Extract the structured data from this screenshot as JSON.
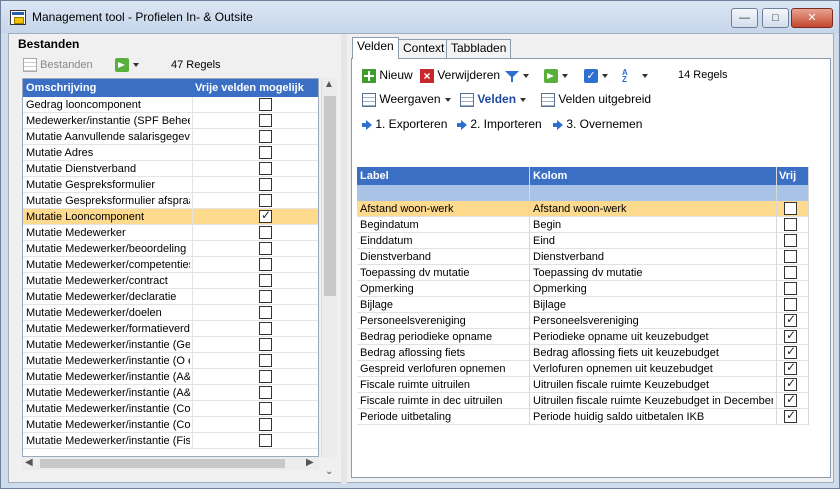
{
  "window": {
    "title": "Management tool - Profielen In- & Outsite"
  },
  "left": {
    "title": "Bestanden",
    "toolbar": {
      "bestanden_label": "Bestanden",
      "count_label": "47 Regels"
    },
    "columns": {
      "name": "Omschrijving",
      "vrij": "Vrije velden mogelijk"
    },
    "rows": [
      {
        "name": "Gedrag looncomponent",
        "checked": false,
        "selected": false
      },
      {
        "name": "Medewerker/instantie (SPF Beheer)",
        "checked": false,
        "selected": false
      },
      {
        "name": "Mutatie Aanvullende salarisgegevens",
        "checked": false,
        "selected": false
      },
      {
        "name": "Mutatie Adres",
        "checked": false,
        "selected": false
      },
      {
        "name": "Mutatie Dienstverband",
        "checked": false,
        "selected": false
      },
      {
        "name": "Mutatie Gespreksformulier",
        "checked": false,
        "selected": false
      },
      {
        "name": "Mutatie Gespreksformulier afspraak",
        "checked": false,
        "selected": false
      },
      {
        "name": "Mutatie Looncomponent",
        "checked": true,
        "selected": true
      },
      {
        "name": "Mutatie Medewerker",
        "checked": false,
        "selected": false
      },
      {
        "name": "Mutatie Medewerker/beoordeling",
        "checked": false,
        "selected": false
      },
      {
        "name": "Mutatie Medewerker/competenties",
        "checked": false,
        "selected": false
      },
      {
        "name": "Mutatie Medewerker/contract",
        "checked": false,
        "selected": false
      },
      {
        "name": "Mutatie Medewerker/declaratie",
        "checked": false,
        "selected": false
      },
      {
        "name": "Mutatie Medewerker/doelen",
        "checked": false,
        "selected": false
      },
      {
        "name": "Mutatie Medewerker/formatieverdeling",
        "checked": false,
        "selected": false
      },
      {
        "name": "Mutatie Medewerker/instantie  (Ge",
        "checked": false,
        "selected": false
      },
      {
        "name": "Mutatie Medewerker/instantie  (O e",
        "checked": false,
        "selected": false
      },
      {
        "name": "Mutatie Medewerker/instantie (A&O",
        "checked": false,
        "selected": false
      },
      {
        "name": "Mutatie Medewerker/instantie (A&O",
        "checked": false,
        "selected": false
      },
      {
        "name": "Mutatie Medewerker/instantie (Cor",
        "checked": false,
        "selected": false
      },
      {
        "name": "Mutatie Medewerker/instantie (Cor",
        "checked": false,
        "selected": false
      },
      {
        "name": "Mutatie Medewerker/instantie (Fisc",
        "checked": false,
        "selected": false
      }
    ]
  },
  "tabs": [
    {
      "label": "Velden",
      "active": true
    },
    {
      "label": "Context",
      "active": false
    },
    {
      "label": "Tabbladen",
      "active": false
    }
  ],
  "right": {
    "toolbar1": {
      "nieuw": "Nieuw",
      "verwijderen": "Verwijderen",
      "count_label": "14 Regels"
    },
    "toolbar2": {
      "weergaven": "Weergaven",
      "velden": "Velden",
      "velden_uitgebreid": "Velden uitgebreid"
    },
    "toolbar3": {
      "exporteren": "1. Exporteren",
      "importeren": "2. Importeren",
      "overnemen": "3. Overnemen"
    },
    "columns": {
      "label": "Label",
      "kolom": "Kolom",
      "vrij": "Vrij"
    },
    "rows": [
      {
        "label": "Afstand woon-werk",
        "kolom": "Afstand woon-werk",
        "vrij": false,
        "selected": true
      },
      {
        "label": "Begindatum",
        "kolom": "Begin",
        "vrij": false,
        "selected": false
      },
      {
        "label": "Einddatum",
        "kolom": "Eind",
        "vrij": false,
        "selected": false
      },
      {
        "label": "Dienstverband",
        "kolom": "Dienstverband",
        "vrij": false,
        "selected": false
      },
      {
        "label": "Toepassing dv mutatie",
        "kolom": "Toepassing dv mutatie",
        "vrij": false,
        "selected": false
      },
      {
        "label": "Opmerking",
        "kolom": "Opmerking",
        "vrij": false,
        "selected": false
      },
      {
        "label": "Bijlage",
        "kolom": "Bijlage",
        "vrij": false,
        "selected": false
      },
      {
        "label": "Personeelsvereniging",
        "kolom": "Personeelsvereniging",
        "vrij": true,
        "selected": false
      },
      {
        "label": "Bedrag periodieke opname",
        "kolom": "Periodieke opname uit keuzebudget",
        "vrij": true,
        "selected": false
      },
      {
        "label": "Bedrag aflossing fiets",
        "kolom": "Bedrag aflossing fiets uit keuzebudget",
        "vrij": true,
        "selected": false
      },
      {
        "label": "Gespreid verlofuren opnemen",
        "kolom": "Verlofuren opnemen uit keuzebudget",
        "vrij": true,
        "selected": false
      },
      {
        "label": "Fiscale ruimte uitruilen",
        "kolom": "Uitruilen fiscale ruimte Keuzebudget",
        "vrij": true,
        "selected": false
      },
      {
        "label": "Fiscale ruimte in dec uitruilen",
        "kolom": "Uitruilen fiscale ruimte Keuzebudget in December",
        "vrij": true,
        "selected": false
      },
      {
        "label": "Periode uitbetaling",
        "kolom": "Periode huidig saldo uitbetalen IKB",
        "vrij": true,
        "selected": false
      }
    ]
  },
  "colors": {
    "header_blue": "#3a6fc4",
    "selection": "#fdda8e",
    "filter_row": "#a8c3e6"
  }
}
